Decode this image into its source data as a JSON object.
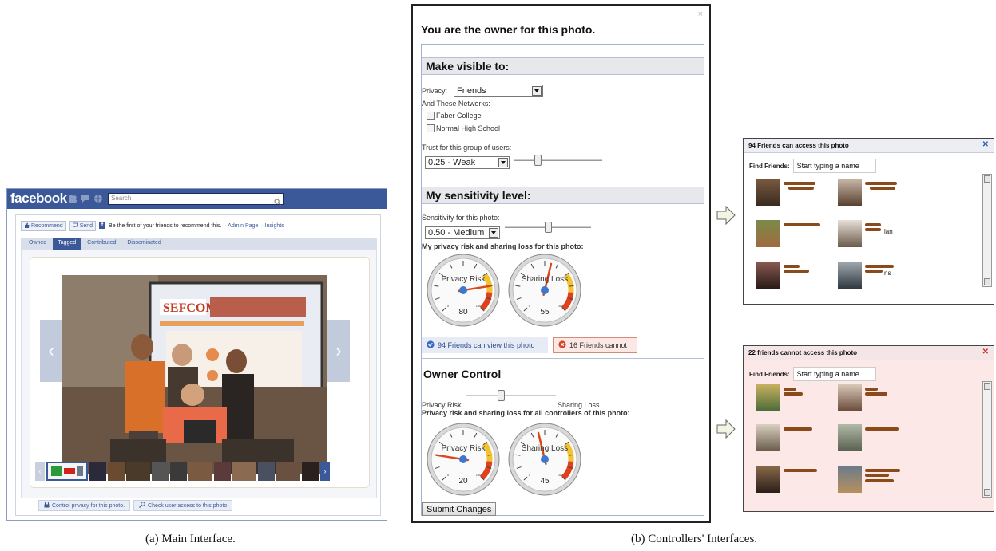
{
  "facebook": {
    "logo": "facebook",
    "search_placeholder": "Search",
    "like_row": {
      "recommend_label": "Recommend",
      "send_label": "Send",
      "message": "Be the first of your friends to recommend this.",
      "admin_link": "· Admin Page",
      "insights_link": "· Insights"
    },
    "tabs": [
      {
        "label": "Owned",
        "active": false
      },
      {
        "label": "Tagged",
        "active": true
      },
      {
        "label": "Contributed",
        "active": false
      },
      {
        "label": "Disseminated",
        "active": false
      }
    ],
    "actions": {
      "control_privacy": "Control privacy for this photo.",
      "check_access": "Check user access to this photo"
    }
  },
  "owner_dialog": {
    "title": "You are the owner for this photo.",
    "visible_section": "Make visible to:",
    "privacy_label": "Privacy:",
    "privacy_value": "Friends",
    "networks_label": "And These Networks:",
    "networks": [
      "Faber College",
      "Normal High School"
    ],
    "trust_label": "Trust for this group of users:",
    "trust_value": "0.25 - Weak",
    "trust_slider": 0.25,
    "sensitivity_section": "My sensitivity level:",
    "sensitivity_label": "Sensitivity for this photo:",
    "sensitivity_value": "0.50 - Medium",
    "sensitivity_slider": 0.5,
    "my_risk_heading": "My privacy risk and sharing loss for this photo:",
    "my_gauges": [
      {
        "label": "Privacy Risk",
        "value": "80",
        "scale_max": "100",
        "scale_min": "0"
      },
      {
        "label": "Sharing Loss",
        "value": "55",
        "scale_max": "100",
        "scale_min": "0"
      }
    ],
    "can_view_button": "94 Friends can view this photo",
    "cannot_button": "16 Friends cannot",
    "owner_control_section": "Owner Control",
    "owner_slider_left": "Privacy Risk",
    "owner_slider_right": "Sharing Loss",
    "owner_slider": 0.38,
    "all_risk_heading": "Privacy risk and sharing loss for all controllers of this photo:",
    "all_gauges": [
      {
        "label": "Privacy Risk",
        "value": "20",
        "scale_max": "100",
        "scale_min": "0"
      },
      {
        "label": "Sharing Loss",
        "value": "45",
        "scale_max": "100",
        "scale_min": "0"
      }
    ],
    "submit_label": "Submit Changes"
  },
  "can_access_popup": {
    "title": "94 Friends can access this photo",
    "find_label": "Find Friends:",
    "find_value": "Start typing a name",
    "visible_name_fragments": [
      "lan",
      "ns"
    ]
  },
  "cannot_access_popup": {
    "title": "22 friends cannot access this photo",
    "find_label": "Find Friends:",
    "find_value": "Start typing a name"
  },
  "captions": {
    "left": "(a)  Main Interface.",
    "right": "(b)  Controllers' Interfaces."
  },
  "colors": {
    "facebook_blue": "#3b5998",
    "gauge_needle": "#d84818",
    "gauge_hub": "#3b78d0",
    "cannot_close": "#d03020",
    "can_close": "#2f5fb0"
  }
}
